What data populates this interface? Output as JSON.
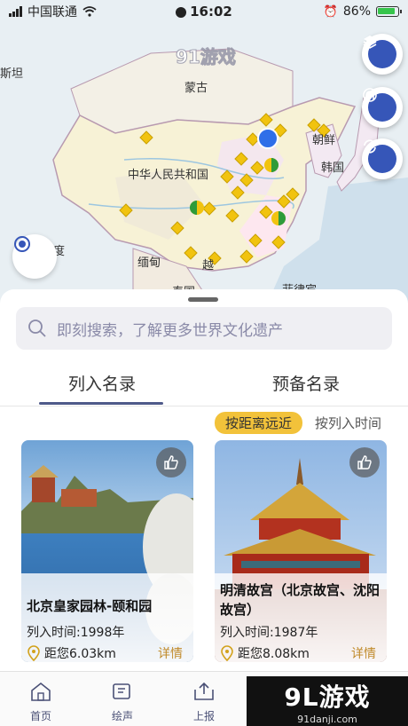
{
  "status": {
    "carrier": "中国联通",
    "time": "16:02",
    "battery": "86%"
  },
  "map": {
    "labels": {
      "mongolia": "蒙古",
      "china": "中华人民共和国",
      "korea_north": "朝鲜",
      "korea_south": "韩国",
      "myanmar": "缅甸",
      "vietnam": "越",
      "thailand": "泰国",
      "philippines": "菲律宾",
      "india_fragment": "度",
      "xinjiang_fragment": "斯坦"
    },
    "watermark": "91游戏",
    "watermark_sub": "91danji.com"
  },
  "search": {
    "placeholder": "即刻搜索，了解更多世界文化遗产"
  },
  "tabs": [
    "列入名录",
    "预备名录"
  ],
  "sorts": {
    "active": "按距离远近",
    "other": "按列入时间"
  },
  "cards": [
    {
      "title": "北京皇家园林-颐和园",
      "year": "列入时间:1998年",
      "distance": "距您6.03km",
      "detail": "详情"
    },
    {
      "title": "明清故宫（北京故宫、沈阳故宫）",
      "year": "列入时间:1987年",
      "distance": "距您8.08km",
      "detail": "详情"
    }
  ],
  "nav": [
    "首页",
    "绘声",
    "上报"
  ],
  "brand": {
    "logo": "9L游戏",
    "site": "91danji.com"
  },
  "colors": {
    "accent": "#3656b8",
    "sort_active": "#f2c23a",
    "detail": "#c08a2a"
  }
}
